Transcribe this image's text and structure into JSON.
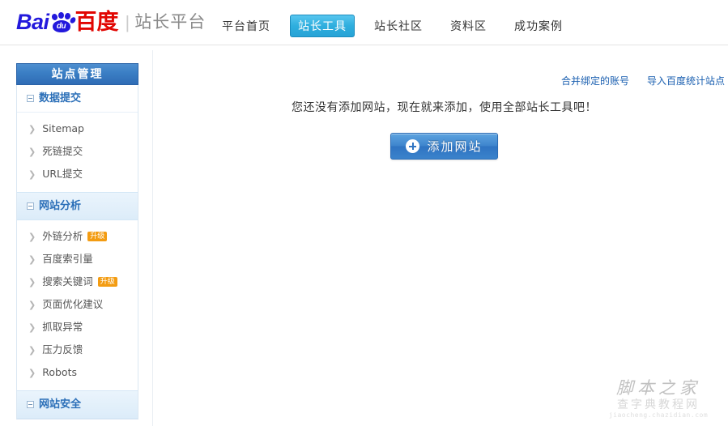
{
  "header": {
    "logo": {
      "text_ba": "Bai",
      "text_i": "i",
      "paw_text": "du",
      "text_cn": "百度",
      "separator": "|",
      "subtitle": "站长平台"
    },
    "nav": [
      {
        "label": "平台首页",
        "active": false
      },
      {
        "label": "站长工具",
        "active": true
      },
      {
        "label": "站长社区",
        "active": false
      },
      {
        "label": "资料区",
        "active": false
      },
      {
        "label": "成功案例",
        "active": false
      }
    ]
  },
  "sidebar": {
    "title": "站点管理",
    "sections": [
      {
        "label": "数据提交",
        "highlight": false,
        "items": [
          {
            "label": "Sitemap",
            "badge": ""
          },
          {
            "label": "死链提交",
            "badge": ""
          },
          {
            "label": "URL提交",
            "badge": ""
          }
        ]
      },
      {
        "label": "网站分析",
        "highlight": true,
        "items": [
          {
            "label": "外链分析",
            "badge": "升级"
          },
          {
            "label": "百度索引量",
            "badge": ""
          },
          {
            "label": "搜索关键词",
            "badge": "升级"
          },
          {
            "label": "页面优化建议",
            "badge": ""
          },
          {
            "label": "抓取异常",
            "badge": ""
          },
          {
            "label": "压力反馈",
            "badge": ""
          },
          {
            "label": "Robots",
            "badge": ""
          }
        ]
      },
      {
        "label": "网站安全",
        "highlight": true,
        "items": []
      }
    ]
  },
  "main": {
    "top_links": [
      {
        "label": "合并绑定的账号"
      },
      {
        "label": "导入百度统计站点"
      }
    ],
    "empty_message": "您还没有添加网站，现在就来添加，使用全部站长工具吧！",
    "add_site_button": "添加网站"
  },
  "watermark": {
    "line1": "脚本之家",
    "line2": "查字典教程网",
    "line3": "jiaocheng.chazidian.com"
  },
  "colors": {
    "brand_blue": "#2319dc",
    "brand_red": "#e10602",
    "active_tab": "#2eaede",
    "sidebar_header": "#3a7ec4",
    "link_blue": "#1a5fb0",
    "badge_orange": "#f39c12"
  }
}
